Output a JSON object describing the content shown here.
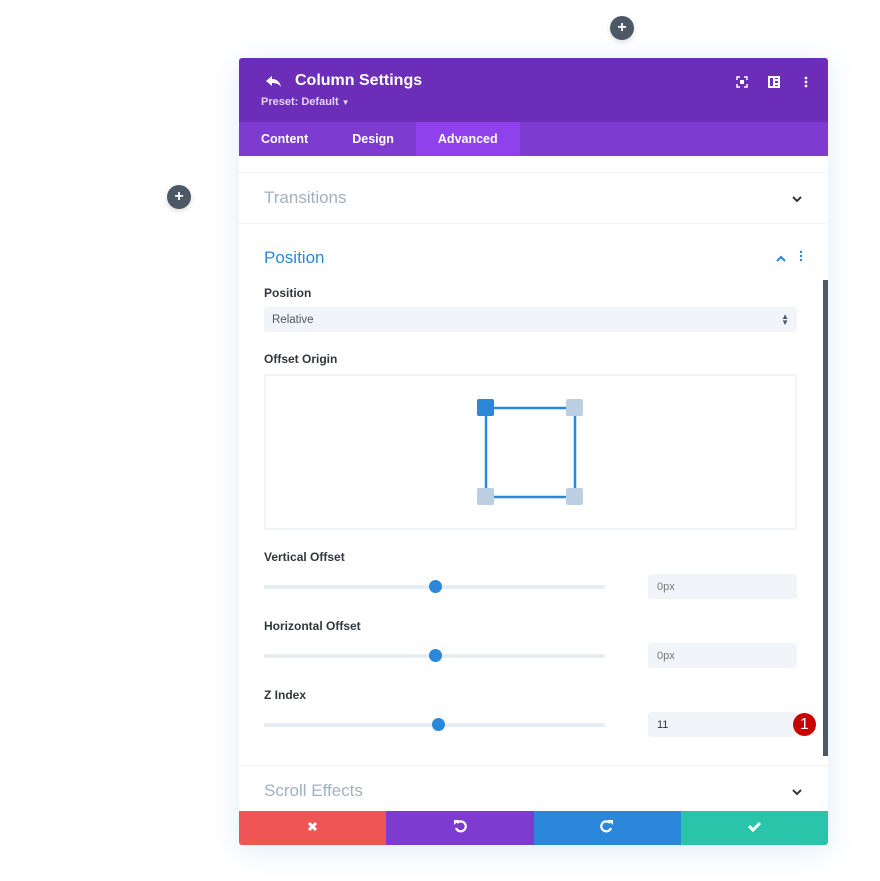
{
  "canvas": {
    "add_row_top_icon": "plus-icon",
    "add_row_left_icon": "plus-icon"
  },
  "modal": {
    "title": "Column Settings",
    "preset": "Preset: Default",
    "back_icon": "undo-arrow-icon",
    "header_icons": [
      "fullscreen-icon",
      "split-view-icon",
      "more-vertical-icon"
    ],
    "tabs": [
      {
        "label": "Content",
        "active": false
      },
      {
        "label": "Design",
        "active": false
      },
      {
        "label": "Advanced",
        "active": true
      }
    ]
  },
  "sections": {
    "transitions": {
      "title": "Transitions",
      "open": false
    },
    "position": {
      "title": "Position",
      "open": true,
      "position_field": {
        "label": "Position",
        "value": "Relative"
      },
      "offset_origin": {
        "label": "Offset Origin",
        "selected": "top-left",
        "corners": [
          "top-left",
          "top-right",
          "bottom-left",
          "bottom-right"
        ]
      },
      "vertical_offset": {
        "label": "Vertical Offset",
        "value": "",
        "placeholder": "0px",
        "slider_percent": 50
      },
      "horizontal_offset": {
        "label": "Horizontal Offset",
        "value": "",
        "placeholder": "0px",
        "slider_percent": 50
      },
      "z_index": {
        "label": "Z Index",
        "value": "11",
        "slider_percent": 51,
        "badge": "1"
      }
    },
    "scroll_effects": {
      "title": "Scroll Effects",
      "open": false
    }
  },
  "footer": {
    "cancel_icon": "close-icon",
    "undo_icon": "undo-icon",
    "redo_icon": "redo-icon",
    "save_icon": "check-icon"
  },
  "colors": {
    "header_bg": "#6c2eb9",
    "tabs_bg": "#7e3bd0",
    "tab_active_bg": "#8f42ec",
    "accent_blue": "#2b87da",
    "cancel": "#ef5555",
    "undo": "#7e3bd0",
    "redo": "#2b87da",
    "save": "#29c4a9",
    "badge": "#c70000"
  }
}
